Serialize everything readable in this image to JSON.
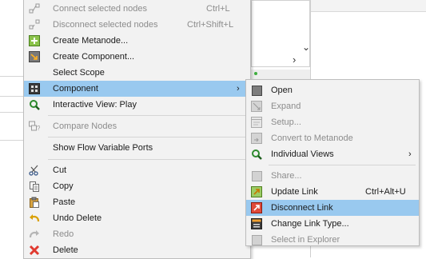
{
  "main_menu": {
    "items": [
      {
        "label": "Connect selected nodes",
        "shortcut": "Ctrl+L",
        "icon": "connect-nodes-icon",
        "disabled": true
      },
      {
        "label": "Disconnect selected nodes",
        "shortcut": "Ctrl+Shift+L",
        "icon": "disconnect-nodes-icon",
        "disabled": true
      },
      {
        "label": "Create Metanode...",
        "icon": "metanode-icon",
        "disabled": false
      },
      {
        "label": "Create Component...",
        "icon": "component-create-icon",
        "disabled": false
      },
      {
        "label": "Select Scope",
        "disabled": false
      },
      {
        "label": "Component",
        "icon": "component-icon",
        "disabled": false,
        "highlighted": true,
        "submenu": true
      },
      {
        "label": "Interactive View: Play",
        "icon": "magnifier-icon",
        "disabled": false
      },
      {
        "label": "Compare Nodes",
        "icon": "compare-nodes-icon",
        "disabled": true
      },
      {
        "label": "Show Flow Variable Ports",
        "disabled": false
      },
      {
        "label": "Cut",
        "icon": "scissors-icon",
        "disabled": false
      },
      {
        "label": "Copy",
        "icon": "copy-icon",
        "disabled": false
      },
      {
        "label": "Paste",
        "icon": "paste-icon",
        "disabled": false
      },
      {
        "label": "Undo Delete",
        "icon": "undo-icon",
        "disabled": false
      },
      {
        "label": "Redo",
        "icon": "redo-icon",
        "disabled": true
      },
      {
        "label": "Delete",
        "icon": "delete-icon",
        "disabled": false
      }
    ]
  },
  "submenu": {
    "items": [
      {
        "label": "Open",
        "icon": "open-icon",
        "disabled": false
      },
      {
        "label": "Expand",
        "icon": "expand-icon",
        "disabled": true
      },
      {
        "label": "Setup...",
        "icon": "setup-icon",
        "disabled": true
      },
      {
        "label": "Convert to Metanode",
        "icon": "convert-icon",
        "disabled": true
      },
      {
        "label": "Individual Views",
        "icon": "magnifier-icon",
        "disabled": false,
        "submenu": true
      },
      {
        "label": "Share...",
        "icon": "share-icon",
        "disabled": true
      },
      {
        "label": "Update Link",
        "shortcut": "Ctrl+Alt+U",
        "icon": "update-link-icon",
        "disabled": false
      },
      {
        "label": "Disconnect Link",
        "icon": "disconnect-link-icon",
        "disabled": false,
        "highlighted": true
      },
      {
        "label": "Change Link Type...",
        "icon": "change-link-type-icon",
        "disabled": false
      },
      {
        "label": "Select in Explorer",
        "icon": "explorer-icon",
        "disabled": true
      }
    ]
  },
  "background": {
    "chevron_down": "⌄",
    "chevron_right": "›"
  },
  "colors": {
    "highlight": "#99c9ef",
    "menu_bg": "#f2f2f2",
    "disabled_text": "#8c8c8c",
    "delete_red": "#e03a2f"
  }
}
